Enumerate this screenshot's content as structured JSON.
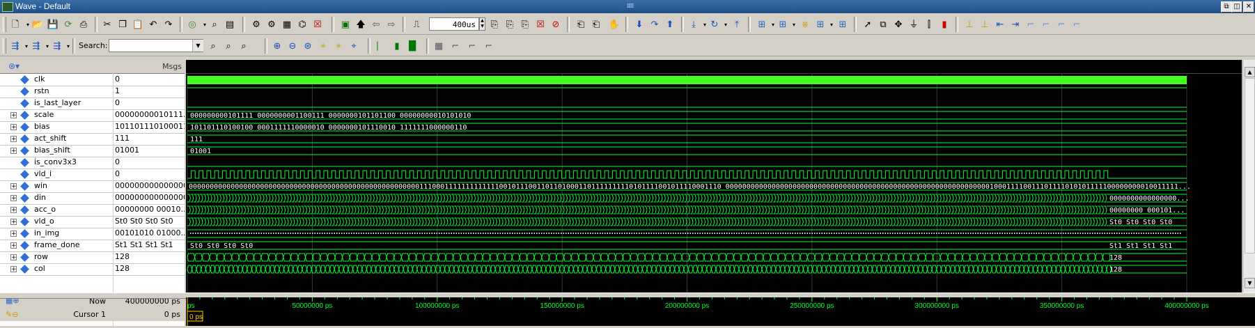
{
  "window": {
    "title": "Wave - Default"
  },
  "toolbar": {
    "time_value": "400us",
    "search_label": "Search:",
    "search_value": ""
  },
  "panes": {
    "msgs_header": "Msgs"
  },
  "signals": [
    {
      "name": "clk",
      "value": "0",
      "expandable": false
    },
    {
      "name": "rstn",
      "value": "1",
      "expandable": false
    },
    {
      "name": "is_last_layer",
      "value": "0",
      "expandable": false
    },
    {
      "name": "scale",
      "value": "00000000010111...",
      "expandable": true
    },
    {
      "name": "bias",
      "value": "101101110100011...",
      "expandable": true
    },
    {
      "name": "act_shift",
      "value": "111",
      "expandable": true
    },
    {
      "name": "bias_shift",
      "value": "01001",
      "expandable": true
    },
    {
      "name": "is_conv3x3",
      "value": "0",
      "expandable": false
    },
    {
      "name": "vld_i",
      "value": "0",
      "expandable": false
    },
    {
      "name": "win",
      "value": "000000000000000...",
      "expandable": true
    },
    {
      "name": "din",
      "value": "000000000000000...",
      "expandable": true
    },
    {
      "name": "acc_o",
      "value": "00000000 00010...",
      "expandable": true
    },
    {
      "name": "vld_o",
      "value": "St0 St0 St0 St0",
      "expandable": true
    },
    {
      "name": "in_img",
      "value": "00101010 01000...",
      "expandable": true
    },
    {
      "name": "frame_done",
      "value": "St1 St1 St1 St1",
      "expandable": true
    },
    {
      "name": "row",
      "value": "128",
      "expandable": true
    },
    {
      "name": "col",
      "value": "128",
      "expandable": true
    }
  ],
  "wave_labels": {
    "scale": "000000000101111 0000000001100111 0000000101101100 00000000010101010",
    "bias": "101101110100100 0001111110000010 0000000101110010 1111111000000110",
    "act_shift": "111",
    "bias_shift": "01001",
    "win": "0000000000000000000000000000000000000000000000000000000111000111111111111100101110011011010001101111111110101111001011110001110 000000000000000000000000000000000000000000000000000000000000000100011110011101111010101111100000000010011111...",
    "din_end": "0000000000000000...",
    "acc_o_end": "00000000 000101...",
    "vld_o_end": "St0 St0 St0 St0",
    "frame_done_start": "St0 St0 St0 St0",
    "frame_done_end": "St1 St1 St1 St1",
    "row_end": "128",
    "col_end": "128"
  },
  "colors": {
    "wave": "#00ff33",
    "clk_fill": "#40ff20",
    "grid": "#3a3a3a",
    "cursor": "#ffcc00",
    "tick_text": "#00ff33"
  },
  "status": {
    "now_label": "Now",
    "now_value": "400000000 ps",
    "cursor_label": "Cursor 1",
    "cursor_value": "0 ps"
  },
  "timeline": {
    "ticks": [
      "ps",
      "50000000 ps",
      "100000000 ps",
      "150000000 ps",
      "200000000 ps",
      "250000000 ps",
      "300000000 ps",
      "350000000 ps",
      "400000000 ps"
    ],
    "cursor_label": "0 ps"
  }
}
